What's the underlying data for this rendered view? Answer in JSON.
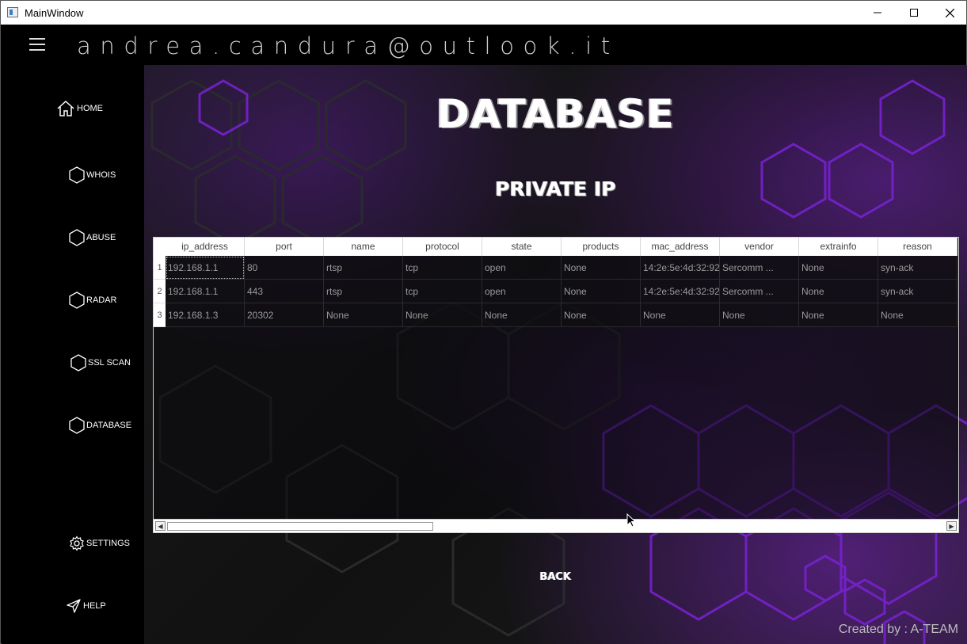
{
  "window": {
    "title": "MainWindow",
    "controls": [
      "minimize-icon",
      "maximize-icon",
      "close-icon"
    ]
  },
  "header": {
    "menu_icon": "hamburger-icon",
    "email": "andrea.candura@outlook.it"
  },
  "sidebar": {
    "items": [
      {
        "label": "HOME",
        "icon": "home-icon"
      },
      {
        "label": "WHOIS",
        "icon": "hexagon-icon"
      },
      {
        "label": "ABUSE",
        "icon": "hexagon-icon"
      },
      {
        "label": "RADAR",
        "icon": "hexagon-icon"
      },
      {
        "label": "SSL SCAN",
        "icon": "hexagon-icon"
      },
      {
        "label": "DATABASE",
        "icon": "hexagon-icon"
      },
      {
        "label": "SETTINGS",
        "icon": "gear-icon"
      },
      {
        "label": "HELP",
        "icon": "send-icon"
      }
    ]
  },
  "main": {
    "title": "DATABASE",
    "subtitle": "PRIVATE IP",
    "table": {
      "columns": [
        "ip_address",
        "port",
        "name",
        "protocol",
        "state",
        "products",
        "mac_address",
        "vendor",
        "extrainfo",
        "reason"
      ],
      "row_numbers": [
        "1",
        "2",
        "3"
      ],
      "rows": [
        [
          "192.168.1.1",
          "80",
          "rtsp",
          "tcp",
          "open",
          "None",
          "14:2e:5e:4d:32:92",
          "Sercomm ...",
          "None",
          "syn-ack"
        ],
        [
          "192.168.1.1",
          "443",
          "rtsp",
          "tcp",
          "open",
          "None",
          "14:2e:5e:4d:32:92",
          "Sercomm ...",
          "None",
          "syn-ack"
        ],
        [
          "192.168.1.3",
          "20302",
          "None",
          "None",
          "None",
          "None",
          "None",
          "None",
          "None",
          "None"
        ]
      ]
    },
    "back_label": "BACK",
    "credit": "Created by : A-TEAM"
  },
  "colors": {
    "accent_purple": "#8a2be2",
    "background": "#000000",
    "text": "#ffffff"
  }
}
